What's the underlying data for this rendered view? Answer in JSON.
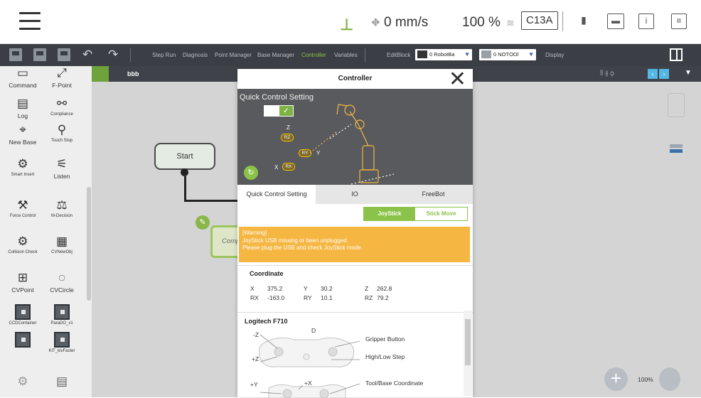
{
  "status_bar": {
    "speed": "0 mm/s",
    "percent": "100 %",
    "badge": "C13A",
    "icons": [
      "menu-icon",
      "robot-state-icon",
      "speed-icon",
      "signal-icon",
      "battery-icon",
      "keyboard-icon",
      "info-icon",
      "log-icon"
    ]
  },
  "toolbar": {
    "menus": [
      "Step Run",
      "Diagnosis",
      "Point Manager",
      "Base Manager",
      "Controller",
      "Variables"
    ],
    "active_menu": "Controller",
    "edit_block": "EditBlock",
    "robot_select": "0 RobotBa",
    "tool_select": "0 NOTOOl",
    "display": "Display",
    "accent": "#8bc34a"
  },
  "palette": {
    "items": [
      {
        "label": "Command",
        "icon": "command-icon"
      },
      {
        "label": "F-Point",
        "icon": "f-point-icon"
      },
      {
        "label": "Log",
        "icon": "log-icon"
      },
      {
        "label": "Compliance",
        "icon": "compliance-icon"
      },
      {
        "label": "New Base",
        "icon": "new-base-icon"
      },
      {
        "label": "Touch Stop",
        "icon": "touch-stop-icon"
      },
      {
        "label": "Smart Insert",
        "icon": "smart-insert-icon"
      },
      {
        "label": "Listen",
        "icon": "listen-icon"
      },
      {
        "label": "Force Control",
        "icon": "force-control-icon"
      },
      {
        "label": "M-Decision",
        "icon": "m-decision-icon"
      },
      {
        "label": "Collision Check",
        "icon": "collision-check-icon"
      },
      {
        "label": "CVNewObj",
        "icon": "cv-new-obj-icon"
      },
      {
        "label": "CVPoint",
        "icon": "cv-point-icon"
      },
      {
        "label": "CVCircle",
        "icon": "cv-circle-icon"
      },
      {
        "label": "CCDContainer",
        "icon": "ccd-container-icon"
      },
      {
        "label": "ParaDO_v1",
        "icon": "para-do-icon"
      },
      {
        "label": "",
        "icon": "block-icon"
      },
      {
        "label": "KIT_kivFaster",
        "icon": "kit-icon"
      },
      {
        "label": "",
        "icon": "settings-icon"
      },
      {
        "label": "",
        "icon": "list-icon"
      }
    ]
  },
  "canvas": {
    "tab_name": "bbb",
    "start_node": "Start",
    "comp_node": "Comp",
    "zoom": "100%"
  },
  "controller": {
    "title": "Controller",
    "qc_title": "Quick Control Setting",
    "axes": {
      "z": "Z",
      "rz": "RZ",
      "ry": "RY",
      "rx": "RX",
      "x": "X",
      "y": "Y"
    },
    "tabs": [
      "Quick Control Setting",
      "IO",
      "FreeBot"
    ],
    "mode_a": "JoyStick",
    "mode_b": "Stick Move",
    "warning": {
      "line1": "[Warning]",
      "line2": "JoyStick USB missing or been unplugged.",
      "line3": "Please plug the USB and check JoyStick mode."
    },
    "coordinate": {
      "title": "Coordinate",
      "rows": [
        [
          {
            "k": "X",
            "v": "375.2"
          },
          {
            "k": "Y",
            "v": "30.2"
          },
          {
            "k": "Z",
            "v": "262.8"
          }
        ],
        [
          {
            "k": "RX",
            "v": "-163.0"
          },
          {
            "k": "RY",
            "v": "10.1"
          },
          {
            "k": "RZ",
            "v": "79.2"
          }
        ]
      ]
    },
    "gamepad": {
      "title": "Logitech F710",
      "labels": {
        "nz": "-Z",
        "pz": "+Z",
        "d": "D",
        "py": "+Y",
        "px": "+X"
      },
      "gripper": "Gripper Button",
      "step": "High/Low Step",
      "tool_base": "Tool/Base Coordinate"
    }
  }
}
